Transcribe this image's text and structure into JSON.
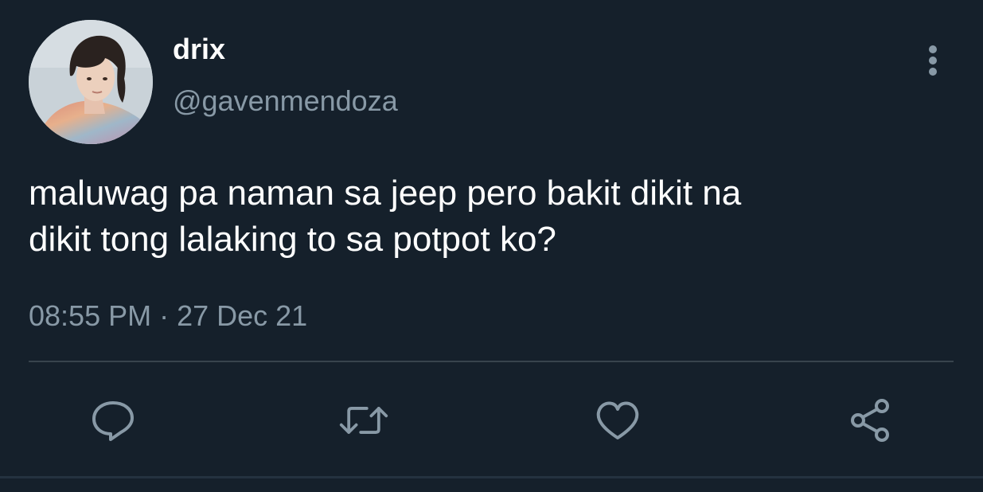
{
  "tweet": {
    "author_name": "drix",
    "author_handle": "@gavenmendoza",
    "text_lines": [
      "maluwag pa naman sa jeep pero bakit dikit na",
      "dikit tong lalaking to sa potpot ko?"
    ],
    "timestamp": "08:55 PM · 27 Dec 21"
  },
  "icons": {
    "more": "more-vertical-icon",
    "reply": "reply-icon",
    "retweet": "retweet-icon",
    "like": "heart-icon",
    "share": "share-icon"
  },
  "colors": {
    "background": "#15202b",
    "text_primary": "#ffffff",
    "text_secondary": "#8899a6",
    "divider": "#38444d"
  }
}
